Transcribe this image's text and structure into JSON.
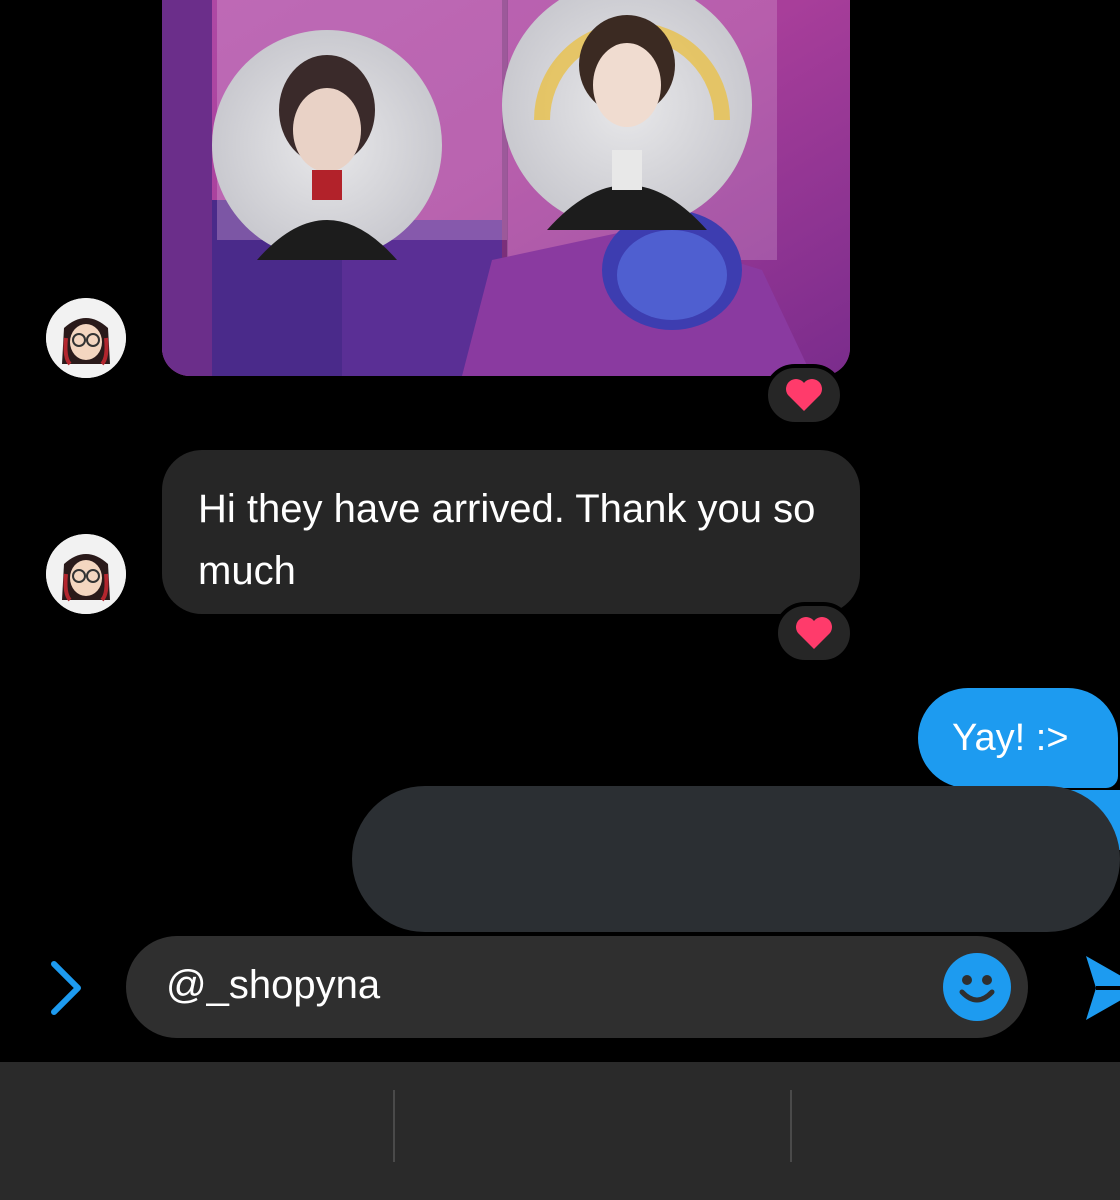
{
  "messages": [
    {
      "type": "image",
      "direction": "incoming",
      "reaction": "heart",
      "description_icon": "photo-card-image"
    },
    {
      "type": "text",
      "direction": "incoming",
      "text": "Hi they have arrived. Thank you so much",
      "reaction": "heart"
    },
    {
      "type": "text",
      "direction": "outgoing",
      "text": "Yay! :>"
    },
    {
      "type": "text",
      "direction": "outgoing",
      "redacted": true
    }
  ],
  "composer": {
    "value": "@_shopyna",
    "expand_icon": "chevron-right-icon",
    "emoji_icon": "smiley-icon",
    "send_icon": "send-icon"
  },
  "colors": {
    "background": "#000000",
    "incoming_bubble": "#262626",
    "outgoing_bubble": "#1d9bf0",
    "accent": "#1d9bf0",
    "reaction_heart": "#ff3b6b"
  }
}
